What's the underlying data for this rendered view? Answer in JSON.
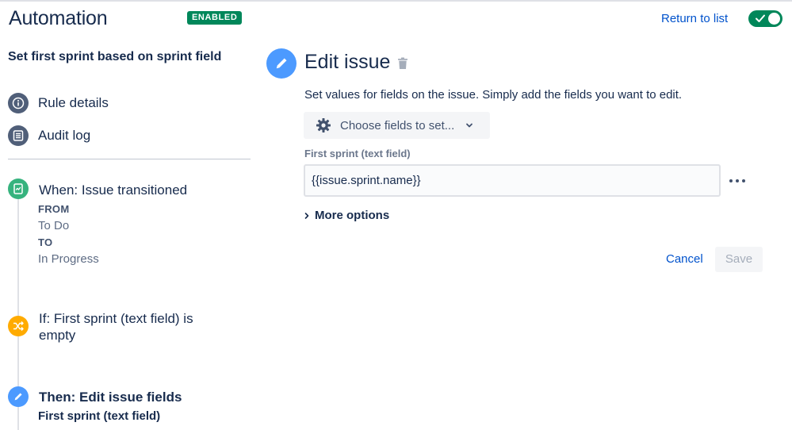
{
  "header": {
    "app_title": "Automation",
    "status_badge": "ENABLED",
    "return_link": "Return to list",
    "rule_enabled": true
  },
  "sidebar": {
    "rule_name": "Set first sprint based on sprint field",
    "nav": [
      {
        "label": "Rule details",
        "icon": "info-icon"
      },
      {
        "label": "Audit log",
        "icon": "list-icon"
      }
    ],
    "steps": {
      "trigger": {
        "title": "When: Issue transitioned",
        "from_label": "FROM",
        "from_value": "To Do",
        "to_label": "TO",
        "to_value": "In Progress",
        "icon": "transition-icon",
        "color": "#36b37e"
      },
      "condition": {
        "title_line1": "If: First sprint (text field) is",
        "title_line2": "empty",
        "icon": "shuffle-icon",
        "color": "#ffab00"
      },
      "action": {
        "title": "Then: Edit issue fields",
        "subtitle": "First sprint (text field)",
        "icon": "pencil-icon",
        "color": "#4c9aff"
      }
    }
  },
  "panel": {
    "title": "Edit issue",
    "description": "Set values for fields on the issue. Simply add the fields you want to edit.",
    "choose_fields_label": "Choose fields to set...",
    "field_label": "First sprint (text field)",
    "field_value": "{{issue.sprint.name}}",
    "more_options_label": "More options",
    "cancel_label": "Cancel",
    "save_label": "Save"
  },
  "colors": {
    "brand_text": "#172b4d",
    "link": "#0052cc",
    "enabled_green": "#00875a"
  }
}
